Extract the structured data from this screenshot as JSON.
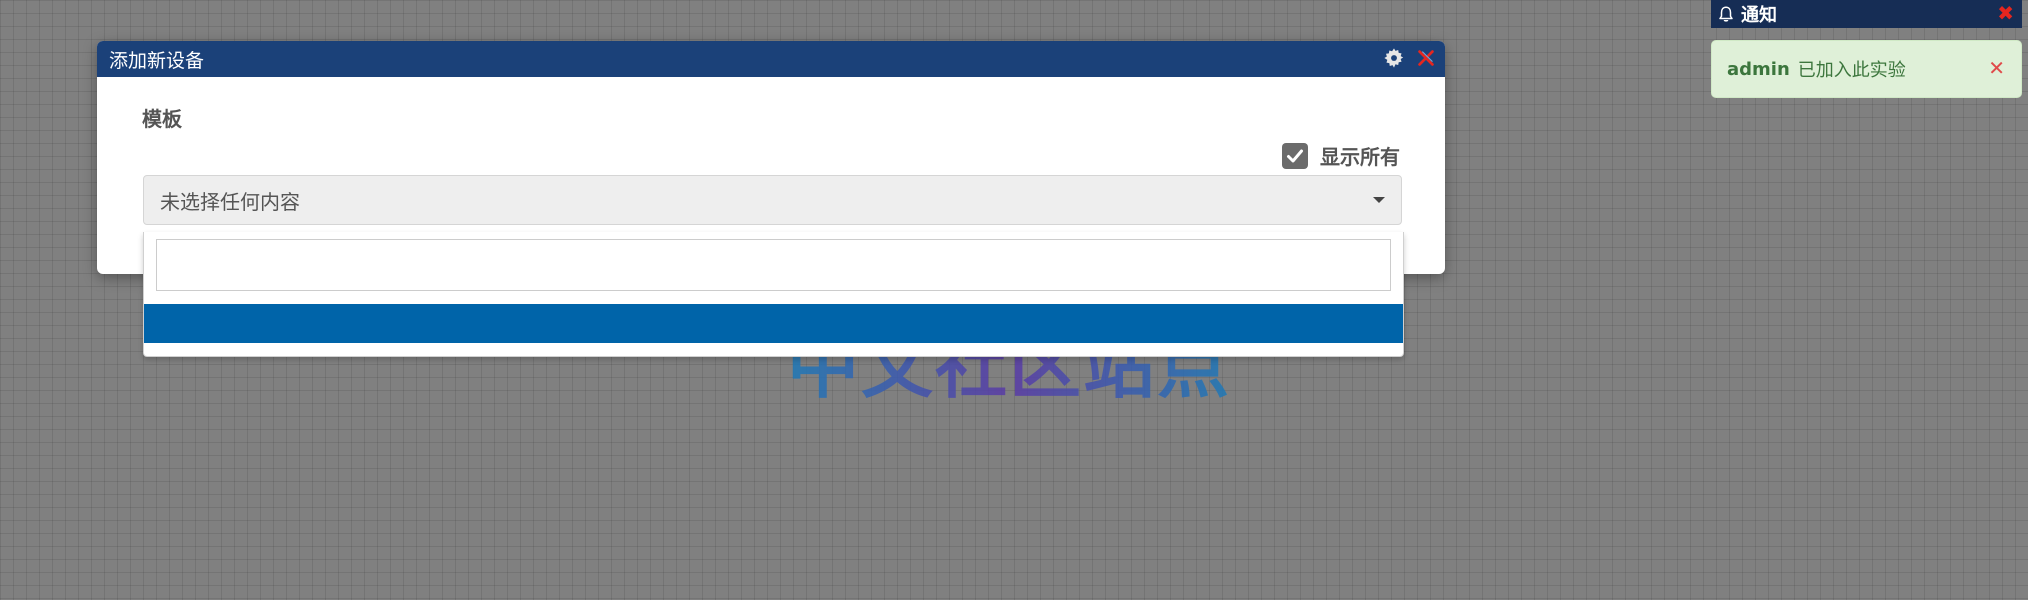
{
  "background": {
    "watermark_text": "中文社区站点"
  },
  "modal": {
    "title": "添加新设备",
    "header_icons": [
      "gear-icon",
      "close-icon"
    ],
    "template_label": "模板",
    "show_all_label": "显示所有",
    "show_all_checked": true,
    "select_value": "未选择任何内容",
    "dropdown": {
      "search_value": "",
      "highlighted_option": ""
    }
  },
  "notifications": {
    "title": "通知",
    "items": [
      {
        "user": "admin",
        "message": "已加入此实验"
      }
    ]
  },
  "colors": {
    "modal_header": "#1b4179",
    "notif_header": "#162d55",
    "dropdown_highlight": "#0064a9",
    "alert_bg": "#dff0d8",
    "alert_text": "#3c763d",
    "close_red": "#e5261f"
  }
}
